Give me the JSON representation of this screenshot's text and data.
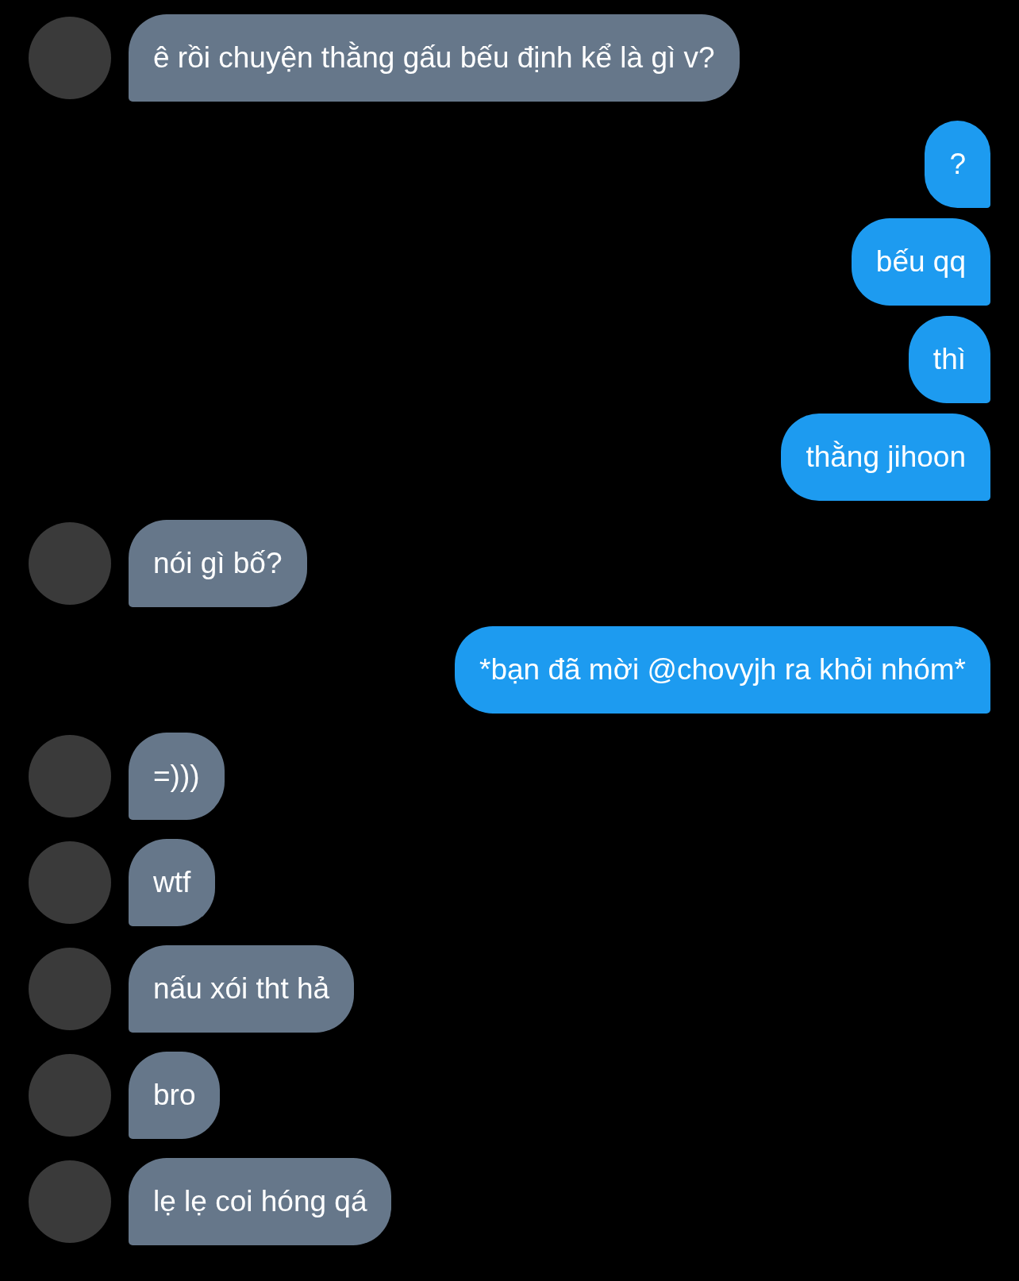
{
  "messages": [
    {
      "kind": "incoming",
      "text": "ê rồi chuyện thằng gấu bếu định kể là gì v?"
    },
    {
      "kind": "outgoing",
      "text": "?"
    },
    {
      "kind": "outgoing",
      "text": "bếu qq"
    },
    {
      "kind": "outgoing",
      "text": "thì"
    },
    {
      "kind": "outgoing",
      "text": "thằng jihoon"
    },
    {
      "kind": "incoming",
      "text": "nói gì bố?"
    },
    {
      "kind": "outgoing",
      "text": "*bạn đã mời @chovyjh ra khỏi nhóm*"
    },
    {
      "kind": "incoming",
      "text": "=)))"
    },
    {
      "kind": "incoming",
      "text": "wtf"
    },
    {
      "kind": "incoming",
      "text": "nấu xói tht hả"
    },
    {
      "kind": "incoming",
      "text": "bro"
    },
    {
      "kind": "incoming",
      "text": "lẹ lẹ coi hóng qá"
    }
  ]
}
